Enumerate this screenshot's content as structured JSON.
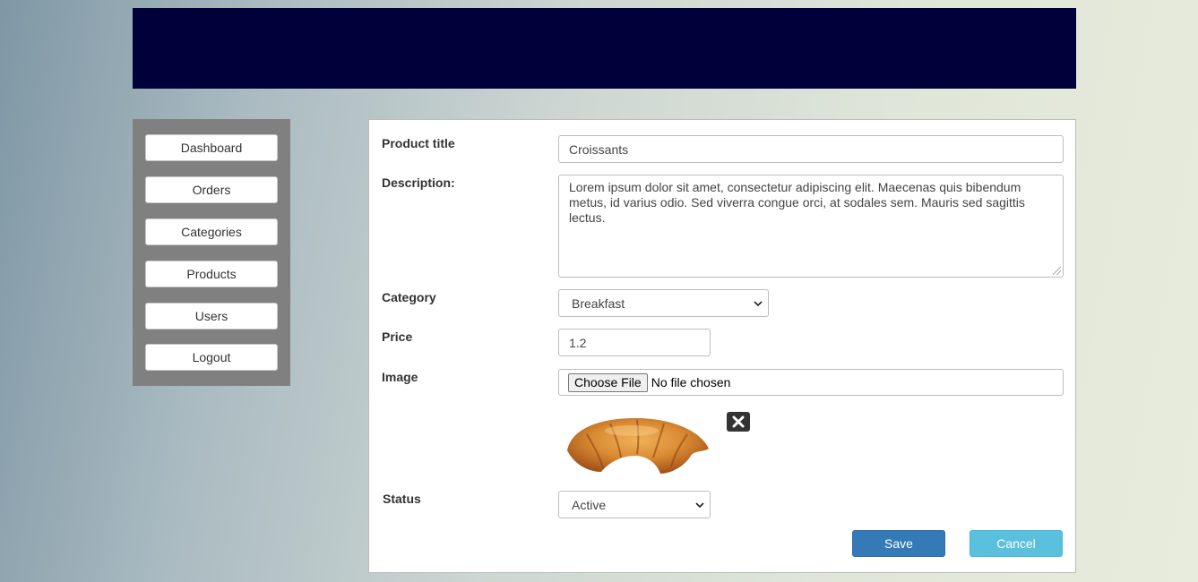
{
  "nav": {
    "items": [
      {
        "label": "Dashboard"
      },
      {
        "label": "Orders"
      },
      {
        "label": "Categories"
      },
      {
        "label": "Products"
      },
      {
        "label": "Users"
      },
      {
        "label": "Logout"
      }
    ]
  },
  "form": {
    "product_title_label": "Product title",
    "product_title_value": "Croissants",
    "description_label": "Description:",
    "description_value": "Lorem ipsum dolor sit amet, consectetur adipiscing elit. Maecenas quis bibendum metus, id varius odio. Sed viverra congue orci, at sodales sem. Mauris sed sagittis lectus.",
    "category_label": "Category",
    "category_value": "Breakfast",
    "price_label": "Price",
    "price_value": "1.2",
    "image_label": "Image",
    "file_button_label": "Choose File",
    "file_status": "No file chosen",
    "image_icon": "croissant-image",
    "remove_icon": "close-icon",
    "status_label": "Status",
    "status_value": "Active",
    "save_label": "Save",
    "cancel_label": "Cancel"
  },
  "colors": {
    "header": "#00003a",
    "sidebar": "#808080",
    "save": "#337ab7",
    "cancel": "#5bc0de"
  }
}
